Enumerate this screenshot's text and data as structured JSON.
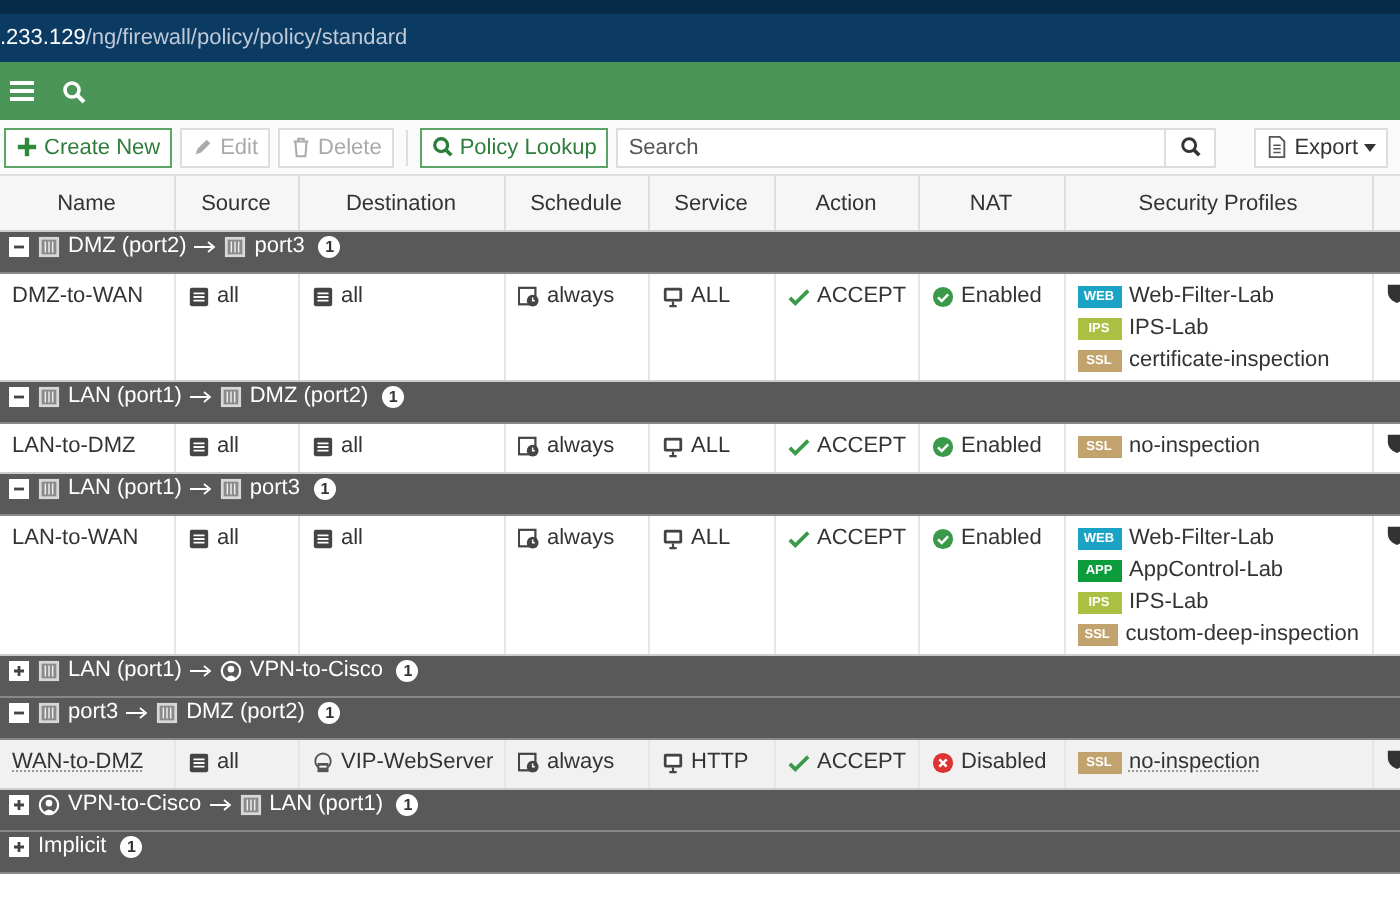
{
  "address_bar": {
    "host": ".233.129",
    "path": "/ng/firewall/policy/policy/standard"
  },
  "toolbar": {
    "buttons": [
      {
        "kind": "create",
        "label": "Create New",
        "disabled": false
      },
      {
        "kind": "edit",
        "label": "Edit",
        "disabled": true
      },
      {
        "kind": "delete",
        "label": "Delete",
        "disabled": true
      },
      {
        "kind": "lookup",
        "label": "Policy Lookup",
        "disabled": false
      }
    ],
    "search": {
      "placeholder": "Search"
    },
    "export": {
      "label": "Export"
    }
  },
  "table": {
    "columns": [
      "Name",
      "Source",
      "Destination",
      "Schedule",
      "Service",
      "Action",
      "NAT",
      "Security Profiles"
    ],
    "groups": [
      {
        "kind": "pair",
        "expanded": true,
        "from": {
          "kind": "interface",
          "name": "DMZ (port2)"
        },
        "to": {
          "kind": "interface",
          "name": "port3"
        },
        "count": "1",
        "policies": [
          {
            "name": "DMZ-to-WAN",
            "selected": false,
            "source": {
              "kind": "address",
              "name": "all"
            },
            "destination": {
              "kind": "address",
              "name": "all"
            },
            "schedule": "always",
            "service": "ALL",
            "action": "ACCEPT",
            "nat": {
              "enabled": true,
              "label": "Enabled"
            },
            "profiles": [
              {
                "kind": "web",
                "tag": "WEB",
                "name": "Web-Filter-Lab"
              },
              {
                "kind": "ips",
                "tag": "IPS",
                "name": "IPS-Lab"
              },
              {
                "kind": "ssl",
                "tag": "SSL",
                "name": "certificate-inspection"
              }
            ]
          }
        ]
      },
      {
        "kind": "pair",
        "expanded": true,
        "from": {
          "kind": "interface",
          "name": "LAN (port1)"
        },
        "to": {
          "kind": "interface",
          "name": "DMZ (port2)"
        },
        "count": "1",
        "policies": [
          {
            "name": "LAN-to-DMZ",
            "selected": false,
            "source": {
              "kind": "address",
              "name": "all"
            },
            "destination": {
              "kind": "address",
              "name": "all"
            },
            "schedule": "always",
            "service": "ALL",
            "action": "ACCEPT",
            "nat": {
              "enabled": true,
              "label": "Enabled"
            },
            "profiles": [
              {
                "kind": "ssl",
                "tag": "SSL",
                "name": "no-inspection"
              }
            ]
          }
        ]
      },
      {
        "kind": "pair",
        "expanded": true,
        "from": {
          "kind": "interface",
          "name": "LAN (port1)"
        },
        "to": {
          "kind": "interface",
          "name": "port3"
        },
        "count": "1",
        "policies": [
          {
            "name": "LAN-to-WAN",
            "selected": false,
            "source": {
              "kind": "address",
              "name": "all"
            },
            "destination": {
              "kind": "address",
              "name": "all"
            },
            "schedule": "always",
            "service": "ALL",
            "action": "ACCEPT",
            "nat": {
              "enabled": true,
              "label": "Enabled"
            },
            "profiles": [
              {
                "kind": "web",
                "tag": "WEB",
                "name": "Web-Filter-Lab"
              },
              {
                "kind": "app",
                "tag": "APP",
                "name": "AppControl-Lab"
              },
              {
                "kind": "ips",
                "tag": "IPS",
                "name": "IPS-Lab"
              },
              {
                "kind": "ssl",
                "tag": "SSL",
                "name": "custom-deep-inspection"
              }
            ]
          }
        ]
      },
      {
        "kind": "pair",
        "expanded": false,
        "from": {
          "kind": "interface",
          "name": "LAN (port1)"
        },
        "to": {
          "kind": "vpn",
          "name": "VPN-to-Cisco"
        },
        "count": "1"
      },
      {
        "kind": "pair",
        "expanded": true,
        "from": {
          "kind": "interface",
          "name": "port3"
        },
        "to": {
          "kind": "interface",
          "name": "DMZ (port2)"
        },
        "count": "1",
        "policies": [
          {
            "name": "WAN-to-DMZ",
            "selected": true,
            "source": {
              "kind": "address",
              "name": "all"
            },
            "destination": {
              "kind": "vip",
              "name": "VIP-WebServer"
            },
            "schedule": "always",
            "service": "HTTP",
            "action": "ACCEPT",
            "nat": {
              "enabled": false,
              "label": "Disabled"
            },
            "profiles": [
              {
                "kind": "ssl",
                "tag": "SSL",
                "name": "no-inspection"
              }
            ]
          }
        ]
      },
      {
        "kind": "pair",
        "expanded": false,
        "from": {
          "kind": "vpn",
          "name": "VPN-to-Cisco"
        },
        "to": {
          "kind": "interface",
          "name": "LAN (port1)"
        },
        "count": "1"
      },
      {
        "kind": "implicit",
        "expanded": false,
        "label": "Implicit",
        "count": "1"
      }
    ]
  }
}
